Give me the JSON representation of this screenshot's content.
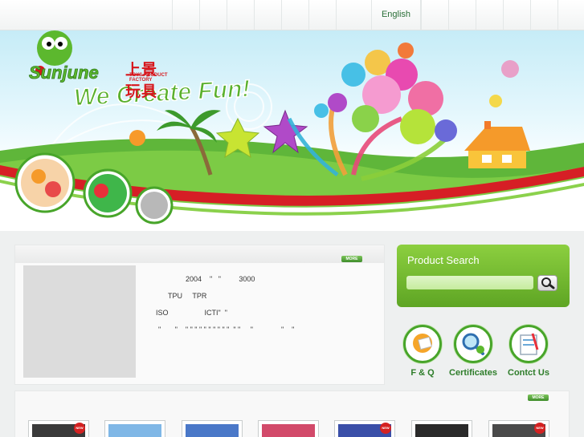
{
  "nav": {
    "language_link": "English"
  },
  "logo": {
    "brand_name": "Sunjune",
    "chinese_name": "上景玩具",
    "tagline": "TOYS PRODUCT FACTORY"
  },
  "banner": {
    "slogan": "We Create Fun!"
  },
  "about": {
    "more_label": "MORE",
    "lines": [
      "2004    \"   \"         3000",
      "TPU     TPR",
      "ISO                  ICTI\"  \"",
      "\"       \"    \" \" \" \" \" \" \" \" \" \"  \" \"     \"              \"    \""
    ]
  },
  "search": {
    "title": "Product Search",
    "input_value": "",
    "button_icon": "magnifier-icon"
  },
  "quick_links": [
    {
      "label": "F & Q",
      "icon": "faq-icon"
    },
    {
      "label": "Certificates",
      "icon": "certificate-icon"
    },
    {
      "label": "Contct Us",
      "icon": "contact-icon"
    }
  ],
  "products": {
    "more_label": "MORE",
    "new_badge": "NEW",
    "items": [
      {
        "new": true,
        "color": "#3a3a3a"
      },
      {
        "new": false,
        "color": "#7fb7e6"
      },
      {
        "new": false,
        "color": "#4a78c8"
      },
      {
        "new": false,
        "color": "#d24a6a"
      },
      {
        "new": true,
        "color": "#3a4fa8"
      },
      {
        "new": false,
        "color": "#2a2a2a"
      },
      {
        "new": true,
        "color": "#4a4a4a"
      }
    ]
  },
  "colors": {
    "brand_red": "#d7161c",
    "brand_green": "#48a52a",
    "search_green": "#6cb52e"
  }
}
